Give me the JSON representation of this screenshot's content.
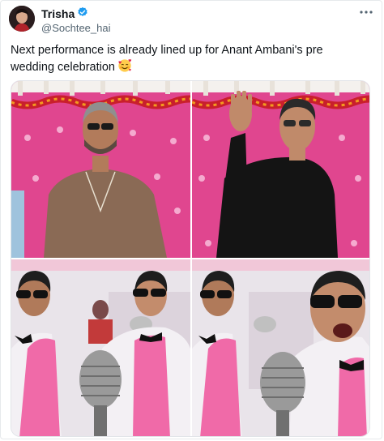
{
  "tweet": {
    "display_name": "Trisha",
    "handle": "@Sochtee_hai",
    "verified": true,
    "text": "Next performance is already lined up for Anant Ambani's pre wedding celebration",
    "emoji": "smiling-face-with-hearts",
    "more_icon": "ellipsis-icon",
    "media": {
      "tiles": [
        {
          "name": "photo-man-in-brown-tshirt",
          "description_icon": "photo"
        },
        {
          "name": "photo-man-waving-black-tshirt",
          "description_icon": "photo"
        },
        {
          "name": "photo-movie-scene-left",
          "description_icon": "photo"
        },
        {
          "name": "photo-movie-scene-right",
          "description_icon": "photo"
        }
      ]
    }
  },
  "colors": {
    "verified_blue": "#1d9bf0",
    "handle_gray": "#536471",
    "backdrop_pink": "#e0468f",
    "suit_pink": "#f06aa8"
  }
}
